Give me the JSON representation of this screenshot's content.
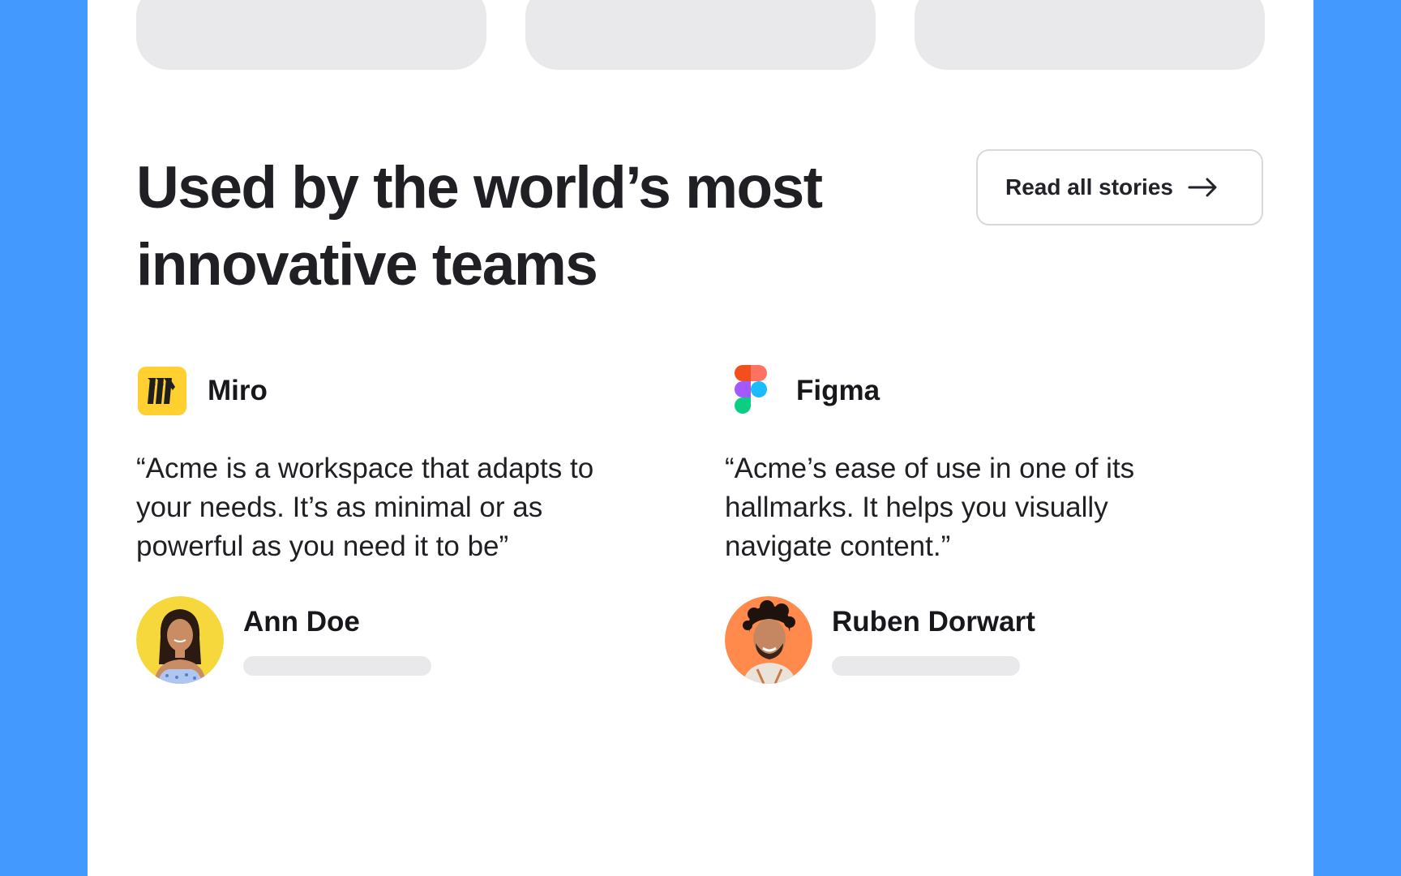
{
  "colors": {
    "frame_background": "#4499FF",
    "page_background": "#FFFFFF",
    "placeholder": "#E9E9EB",
    "text_primary": "#1F1F24",
    "miro_yellow": "#FFD02F",
    "ann_avatar_bg": "#F6D83C",
    "ruben_avatar_bg": "#FF8A4C"
  },
  "headline": {
    "line1": "Used by the world’s most",
    "line2": "innovative teams"
  },
  "cta": {
    "label": "Read all stories",
    "icon": "arrow-right-icon"
  },
  "testimonials": [
    {
      "company": "Miro",
      "logo_icon": "miro-logo",
      "quote": "“Acme is a workspace that adapts to your needs. It’s as minimal or as powerful as you need it to be”",
      "author": "Ann Doe",
      "avatar": "ann-doe-avatar"
    },
    {
      "company": "Figma",
      "logo_icon": "figma-logo",
      "quote": "“Acme’s ease of use in one of its hallmarks. It helps you visually navigate content.”",
      "author": "Ruben Dorwart",
      "avatar": "ruben-dorwart-avatar"
    }
  ]
}
